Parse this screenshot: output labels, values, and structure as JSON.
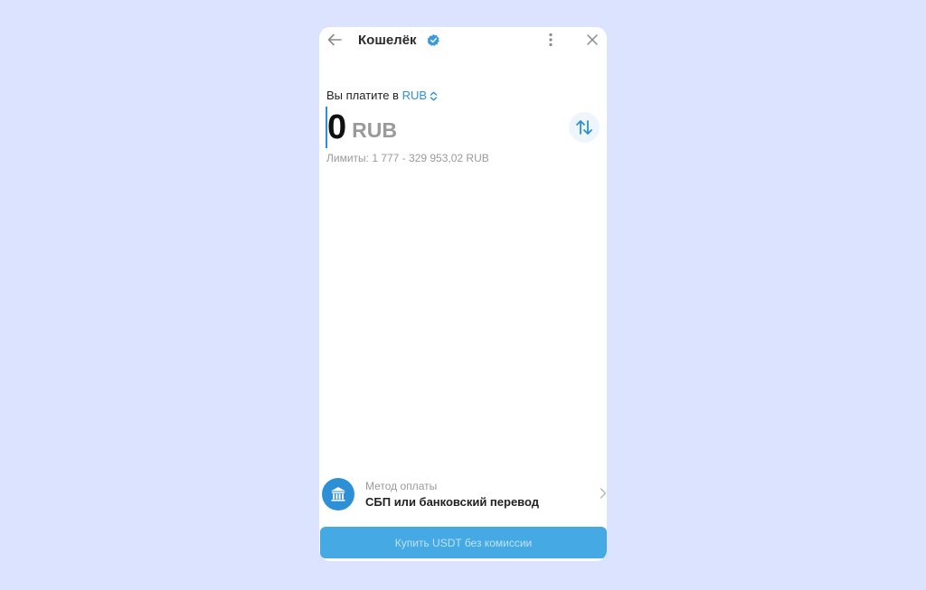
{
  "header": {
    "title": "Кошелёк",
    "back_icon": "arrow-left-icon",
    "verified_icon": "verified-badge-icon",
    "menu_icon": "more-vertical-icon",
    "close_icon": "close-icon"
  },
  "payment": {
    "pay_in_label": "Вы платите в",
    "currency": "RUB",
    "amount": "0",
    "amount_currency": "RUB",
    "limits": "Лимиты: 1 777 - 329 953,02 RUB"
  },
  "method": {
    "label": "Метод оплаты",
    "value": "СБП или банковский перевод",
    "icon": "bank-icon"
  },
  "buy_button": {
    "label": "Купить USDT без комиссии"
  },
  "colors": {
    "accent": "#2d8fd5",
    "button": "#45a9e4",
    "background": "#dbe3fe"
  }
}
